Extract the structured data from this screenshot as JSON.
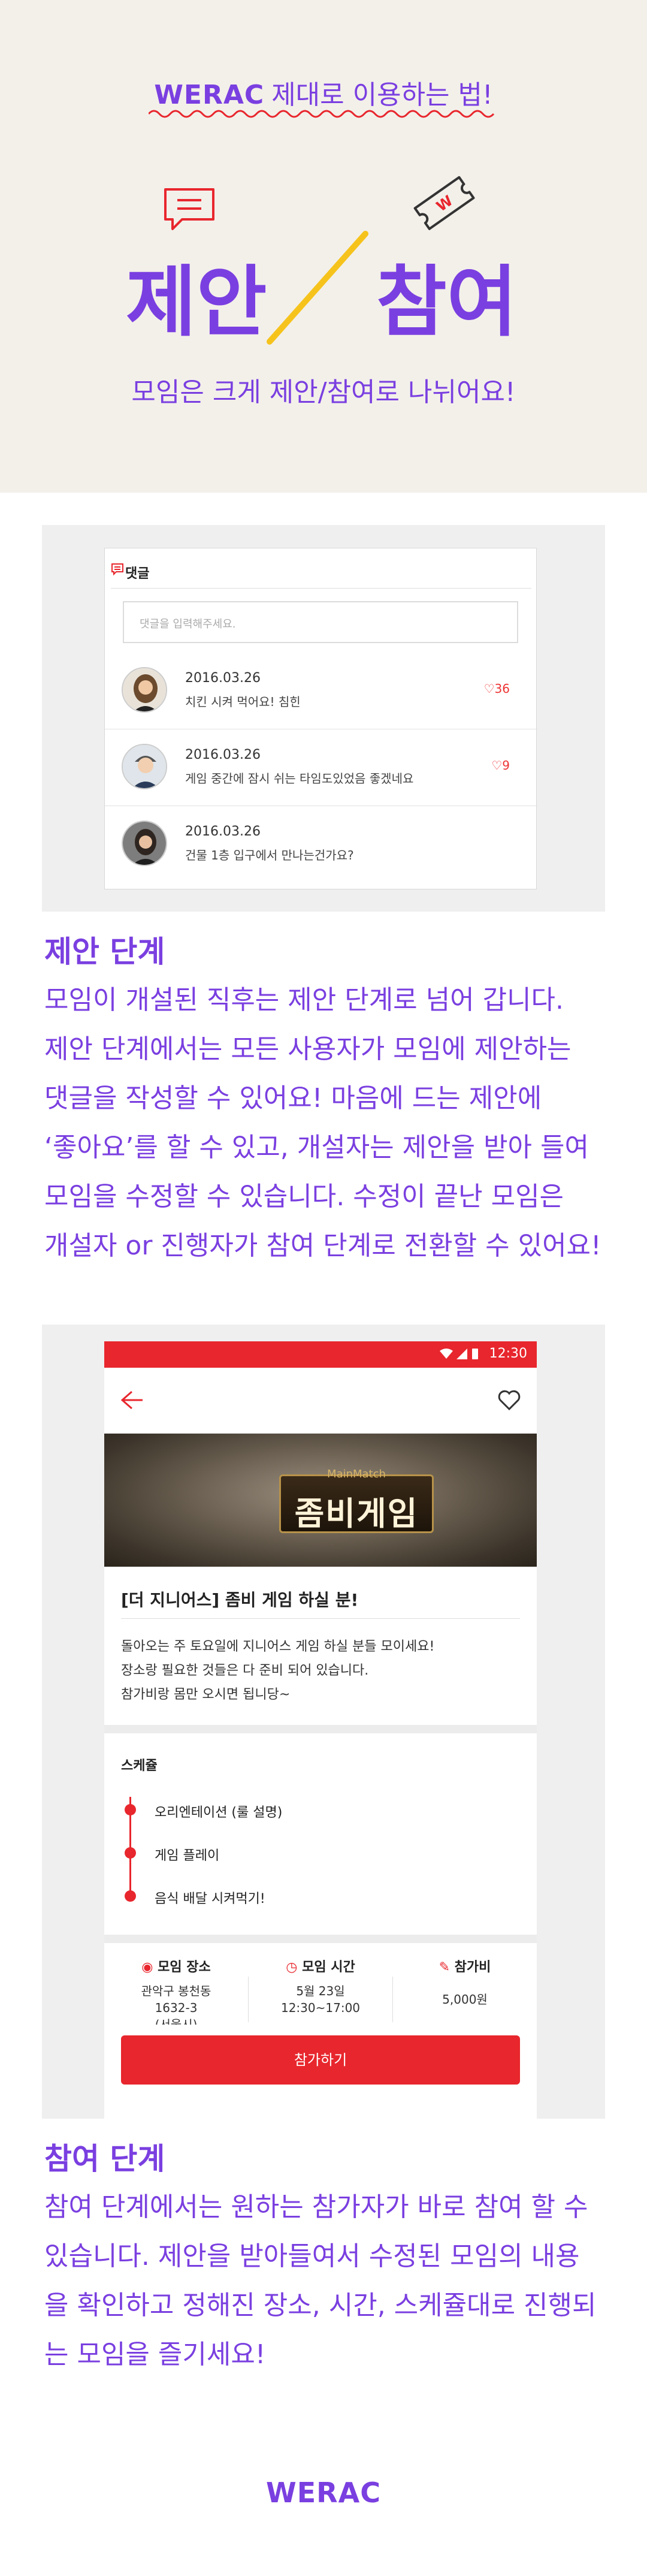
{
  "hero": {
    "brand": "WERAC",
    "heading_rest": "제대로 이용하는 법!",
    "word_left": "제안",
    "word_right": "참여",
    "subtitle": "모임은 크게 제안/참여로 나뉘어요!"
  },
  "comments_mock": {
    "title": "댓글",
    "input_placeholder": "댓글을 입력해주세요.",
    "items": [
      {
        "date": "2016.03.26",
        "text": "치킨 시켜 먹어요! 침힌",
        "likes": "36"
      },
      {
        "date": "2016.03.26",
        "text": "게임 중간에 잠시 쉬는 타임도있었음 좋겠네요",
        "likes": "9"
      },
      {
        "date": "2016.03.26",
        "text": "건물 1층 입구에서 만나는건가요?",
        "likes": ""
      }
    ]
  },
  "section1": {
    "heading": "제안 단계",
    "lines": [
      "모임이 개설된 직후는 제안 단계로 넘어 갑니다.",
      "제안 단계에서는 모든 사용자가 모임에 제안하는",
      "댓글을 작성할 수 있어요! 마음에 드는 제안에",
      "‘좋아요’를 할 수 있고, 개설자는 제안을 받아 들여",
      "모임을 수정할 수 있습니다. 수정이 끝난 모임은",
      "개설자 or 진행자가 참여 단계로 전환할 수 있어요!"
    ]
  },
  "event_mock": {
    "status_time": "12:30",
    "banner_top": "MainMatch",
    "banner_title": "좀비게임",
    "title": "[더 지니어스] 좀비 게임 하실 분!",
    "desc_lines": [
      "돌아오는 주 토요일에 지니어스 게임 하실 분들 모이세요!",
      "장소랑 필요한 것들은 다 준비 되어 있습니다.",
      "참가비랑 몸만 오시면 됩니당~"
    ],
    "schedule_title": "스케쥴",
    "schedule": [
      "오리엔테이션 (룰 설명)",
      "게임 플레이",
      "음식 배달 시켜먹기!"
    ],
    "place_head": "모임 장소",
    "place_val_1": "관악구 봉천동",
    "place_val_2": "1632-3",
    "place_val_3": "(서울시)",
    "time_head": "모임 시간",
    "time_val_1": "5월 23일",
    "time_val_2": "12:30~17:00",
    "fee_head": "참가비",
    "fee_val": "5,000원",
    "join_button": "참가하기"
  },
  "section2": {
    "heading": "참여 단계",
    "lines": [
      "참여 단계에서는 원하는 참가자가 바로 참여 할 수",
      "있습니다. 제안을 받아들여서 수정된 모임의 내용",
      "을 확인하고 정해진 장소, 시간, 스케쥴대로 진행되",
      "는 모임을 즐기세요!"
    ]
  },
  "footer": {
    "brand": "WERAC"
  },
  "colors": {
    "accent": "#7a3fe0",
    "red": "#e8262d",
    "hero_bg": "#f3f0ea",
    "slash": "#f6c31c"
  }
}
